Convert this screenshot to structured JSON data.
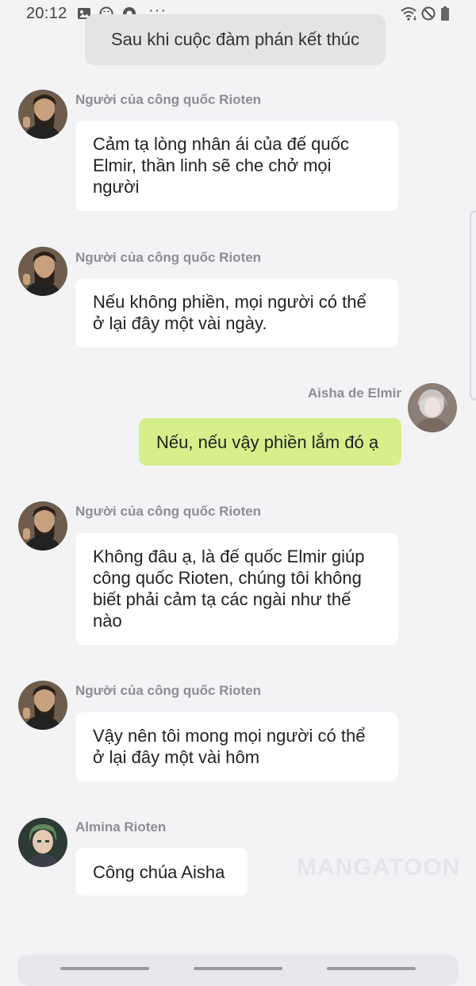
{
  "status_bar": {
    "time": "20:12",
    "more": "···",
    "left_icons": [
      "gallery-icon",
      "emoji-icon",
      "chat-app-icon"
    ],
    "right_icons": [
      "wifi-icon",
      "do-not-disturb-icon",
      "battery-icon"
    ]
  },
  "narration": "Sau khi cuộc đàm phán kết thúc",
  "messages": [
    {
      "speaker": "Người của công quốc Rioten",
      "side": "left",
      "lines": [
        "Cảm tạ lòng nhân ái của đế quốc",
        "Elmir, thần linh sẽ che chở mọi",
        "người"
      ]
    },
    {
      "speaker": "Người của công quốc Rioten",
      "side": "left",
      "lines": [
        "Nếu không phiền, mọi người có thể",
        "ở lại đây một vài ngày."
      ]
    },
    {
      "speaker": "Aisha de Elmir",
      "side": "right",
      "lines": [
        "Nếu, nếu vậy phiền lắm đó ạ"
      ]
    },
    {
      "speaker": "Người của công quốc Rioten",
      "side": "left",
      "lines": [
        "Không đâu ạ, là đế quốc Elmir giúp",
        "công quốc Rioten, chúng tôi không",
        "biết phải cảm tạ các ngài như thế",
        "nào"
      ]
    },
    {
      "speaker": "Người của công quốc Rioten",
      "side": "left",
      "lines": [
        "Vậy nên tôi mong mọi người có thể",
        "ở lại đây một vài hôm"
      ]
    },
    {
      "speaker": "Almina Rioten",
      "side": "left",
      "lines": [
        "Công chúa Aisha"
      ]
    }
  ],
  "watermark": "MANGATOON",
  "colors": {
    "background": "#f3f3f6",
    "bubble": "#ffffff",
    "bubble_self": "#d5f08a",
    "speaker": "#8d8d94"
  }
}
